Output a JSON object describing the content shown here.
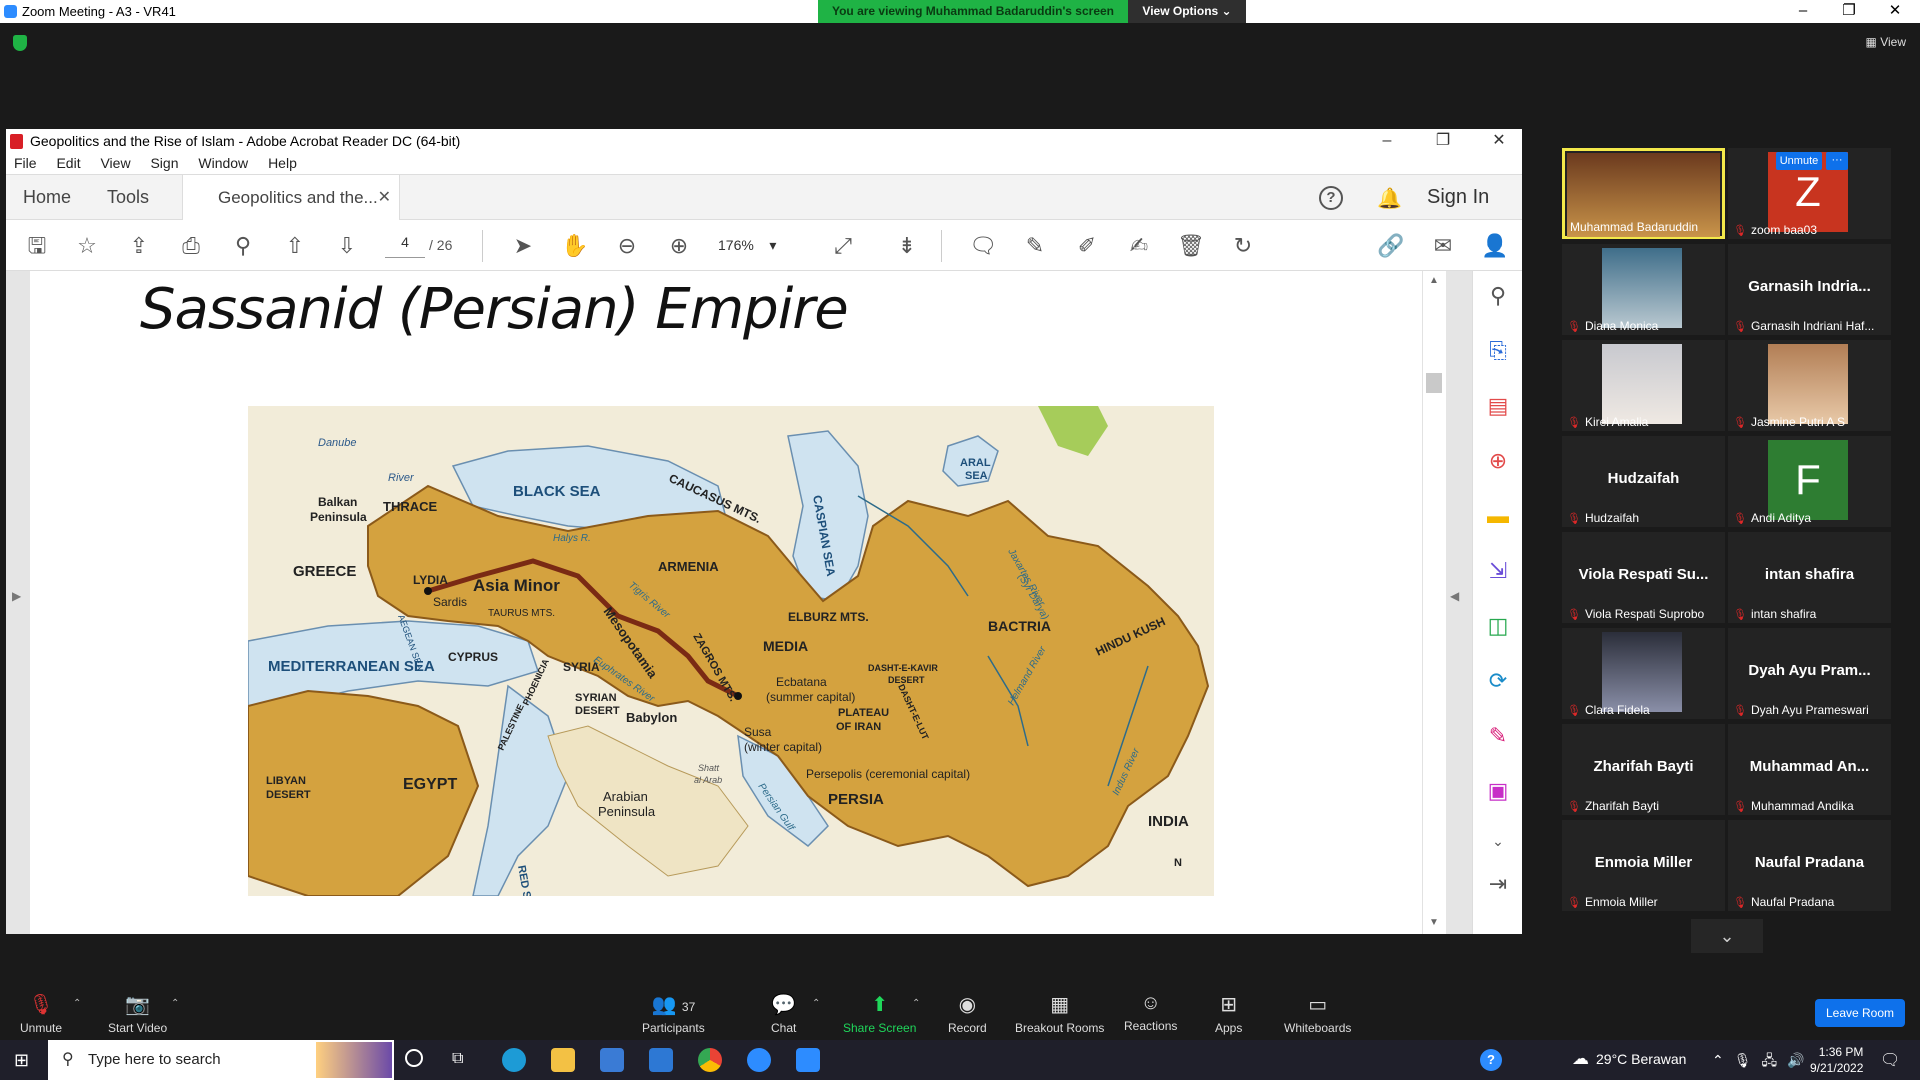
{
  "zoom": {
    "window_title": "Zoom Meeting - A3 - VR41",
    "viewing_banner": "You are viewing Muhammad Badaruddin's screen",
    "view_options": "View Options",
    "view_label": "View"
  },
  "acrobat": {
    "title": "Geopolitics and the Rise of Islam - Adobe Acrobat Reader DC (64-bit)",
    "menu": [
      "File",
      "Edit",
      "View",
      "Sign",
      "Window",
      "Help"
    ],
    "home_tab": "Home",
    "tools_tab": "Tools",
    "doc_tab": "Geopolitics and the...",
    "sign_in": "Sign In",
    "page_current": "4",
    "page_total": "/ 26",
    "zoom_level": "176%",
    "slide_title": "Sassanid (Persian) Empire"
  },
  "map_labels": {
    "danube": "Danube",
    "river": "River",
    "balkan": "Balkan",
    "peninsula": "Peninsula",
    "thrace": "THRACE",
    "black_sea": "BLACK SEA",
    "caucasus": "CAUCASUS MTS.",
    "caspian": "CASPIAN SEA",
    "aral": "ARAL",
    "aral_sea": "SEA",
    "greece": "GREECE",
    "lydia": "LYDIA",
    "sardis": "Sardis",
    "asia_minor": "Asia Minor",
    "aegean": "AEGEAN SEA",
    "armenia": "ARMENIA",
    "halys": "Halys R.",
    "tigris": "Tigris River",
    "taurus": "TAURUS MTS.",
    "mesopotamia": "Mesopotamia",
    "zagros": "ZAGROS MTS.",
    "elburz": "ELBURZ MTS.",
    "media": "MEDIA",
    "bactria": "BACTRIA",
    "jaxartes": "Jaxartes River",
    "syr": "(Syr Darya)",
    "hindu_kush": "HINDU KUSH",
    "cyprus": "CYPRUS",
    "mediterranean": "MEDITERRANEAN SEA",
    "syria": "SYRIA",
    "euphrates": "Euphrates River",
    "ecbatana": "Ecbatana",
    "summer": "(summer capital)",
    "dasht_kavir": "DASHT-E-KAVIR",
    "desert": "DESERT",
    "plateau": "PLATEAU",
    "of_iran": "OF IRAN",
    "dasht_lut": "DASHT-E-LUT",
    "helmand": "Helmand River",
    "syrian_desert": "SYRIAN",
    "desert2": "DESERT",
    "babylon": "Babylon",
    "susa": "Susa",
    "winter": "(winter capital)",
    "palestine": "PALESTINE",
    "phoenicia": "PHOENICIA",
    "libyan": "LIBYAN",
    "desert3": "DESERT",
    "egypt": "EGYPT",
    "arabian": "Arabian",
    "arabian2": "Peninsula",
    "shatt": "Shatt",
    "al_arab": "al Arab",
    "persepolis": "Persepolis (ceremonial capital)",
    "persia": "PERSIA",
    "persian_gulf": "Persian Gulf",
    "indus": "Indus River",
    "india": "INDIA",
    "red_sea": "RED SEA",
    "north": "N"
  },
  "participants": [
    {
      "name": "Muhammad Badaruddin",
      "big": "",
      "type": "photo",
      "muted": false,
      "active": true
    },
    {
      "name": "zoom baa03",
      "big": "Z",
      "type": "letter",
      "color": "#c8341f",
      "muted": true,
      "active": false
    },
    {
      "name": "Diana Monica",
      "big": "",
      "type": "photo",
      "muted": true,
      "active": false
    },
    {
      "name": "Garnasih Indriani Haf...",
      "big": "Garnasih  Indria...",
      "type": "text",
      "muted": true,
      "active": false
    },
    {
      "name": "Kirei Amalia",
      "big": "",
      "type": "photo",
      "muted": true,
      "active": false
    },
    {
      "name": "Jasmine Putri A S",
      "big": "",
      "type": "photo",
      "muted": true,
      "active": false
    },
    {
      "name": "Hudzaifah",
      "big": "Hudzaifah",
      "type": "text",
      "muted": true,
      "active": false
    },
    {
      "name": "Andi Aditya",
      "big": "F",
      "type": "letter",
      "color": "#2e7d32",
      "muted": true,
      "active": false
    },
    {
      "name": "Viola Respati Suprobo",
      "big": "Viola  Respati  Su...",
      "type": "text",
      "muted": true,
      "active": false
    },
    {
      "name": "intan shafira",
      "big": "intan  shafira",
      "type": "text",
      "muted": true,
      "active": false
    },
    {
      "name": "Clara Fidela",
      "big": "",
      "type": "photo",
      "muted": true,
      "active": false
    },
    {
      "name": "Dyah Ayu Prameswari",
      "big": "Dyah  Ayu  Pram...",
      "type": "text",
      "muted": true,
      "active": false
    },
    {
      "name": "Zharifah Bayti",
      "big": "Zharifah  Bayti",
      "type": "text",
      "muted": true,
      "active": false
    },
    {
      "name": "Muhammad Andika",
      "big": "Muhammad  An...",
      "type": "text",
      "muted": true,
      "active": false
    },
    {
      "name": "Enmoia Miller",
      "big": "Enmoia  Miller",
      "type": "text",
      "muted": true,
      "active": false
    },
    {
      "name": "Naufal Pradana",
      "big": "Naufal  Pradana",
      "type": "text",
      "muted": true,
      "active": false
    }
  ],
  "unmute_badge": "Unmute",
  "toolbar": {
    "unmute": "Unmute",
    "start_video": "Start Video",
    "participants": "Participants",
    "participant_count": "37",
    "chat": "Chat",
    "share": "Share Screen",
    "record": "Record",
    "breakout": "Breakout Rooms",
    "reactions": "Reactions",
    "apps": "Apps",
    "whiteboards": "Whiteboards",
    "leave": "Leave Room"
  },
  "taskbar": {
    "search_placeholder": "Type here to search",
    "weather": "29°C  Berawan",
    "time": "1:36 PM",
    "date": "9/21/2022"
  },
  "colors": {
    "zoom_green": "#1fb345",
    "zoom_blue": "#0e71eb",
    "empire": "#d4a23f",
    "sea": "#cfe3f0",
    "highlight_border": "#f3e94a"
  }
}
